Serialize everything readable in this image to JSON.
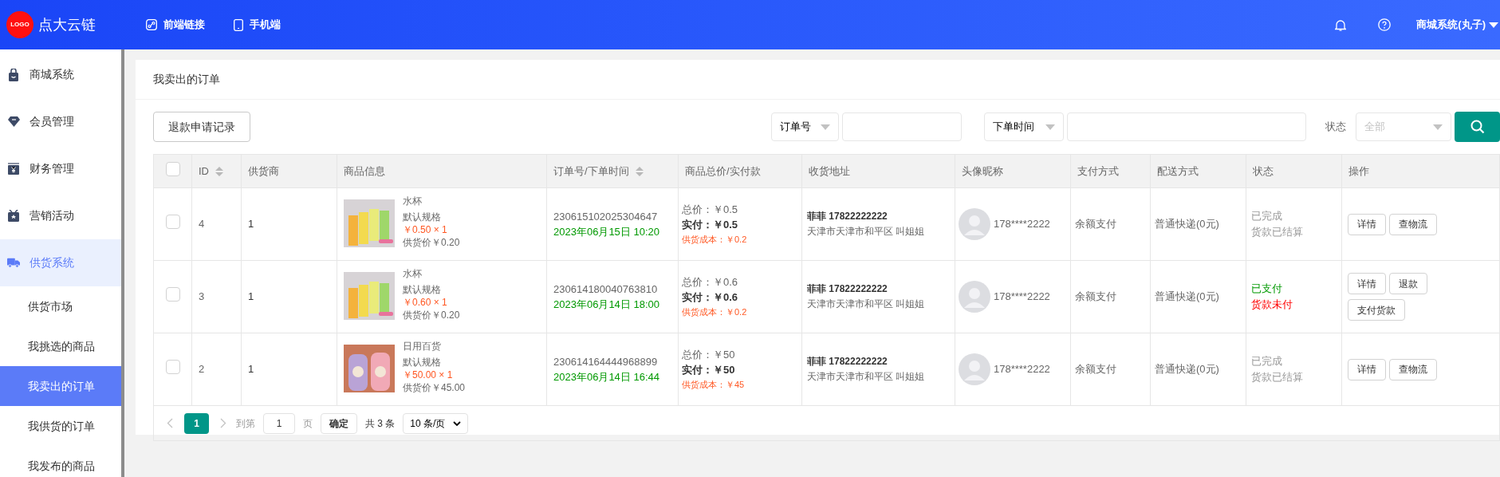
{
  "header": {
    "logo": "LOGO",
    "brand": "点大云链",
    "nav": [
      {
        "label": "前端链接",
        "kind": "link"
      },
      {
        "label": "手机端",
        "kind": "phone"
      }
    ],
    "user": "商城系统(丸子)"
  },
  "sidebar": {
    "items": [
      {
        "label": "商城系统",
        "selected": false
      },
      {
        "label": "会员管理",
        "selected": false
      },
      {
        "label": "财务管理",
        "selected": false
      },
      {
        "label": "营销活动",
        "selected": false
      },
      {
        "label": "供货系统",
        "selected": true,
        "children": [
          {
            "label": "供货市场",
            "selected": false
          },
          {
            "label": "我挑选的商品",
            "selected": false
          },
          {
            "label": "我卖出的订单",
            "selected": true
          },
          {
            "label": "我供货的订单",
            "selected": false
          },
          {
            "label": "我发布的商品",
            "selected": false
          }
        ]
      }
    ]
  },
  "page_title": "我卖出的订单",
  "toolbar": {
    "refund_button": "退款申请记录",
    "order_field": "订单号",
    "time_field": "下单时间",
    "status_label": "状态",
    "status_placeholder": "全部"
  },
  "table": {
    "columns": [
      {
        "label": "ID",
        "sortable": true
      },
      {
        "label": "供货商",
        "sortable": false
      },
      {
        "label": "商品信息",
        "sortable": false
      },
      {
        "label": "订单号/下单时间",
        "sortable": true
      },
      {
        "label": "商品总价/实付款",
        "sortable": false
      },
      {
        "label": "收货地址",
        "sortable": false
      },
      {
        "label": "头像昵称",
        "sortable": false
      },
      {
        "label": "支付方式",
        "sortable": false
      },
      {
        "label": "配送方式",
        "sortable": false
      },
      {
        "label": "状态",
        "sortable": false
      },
      {
        "label": "操作",
        "sortable": false
      }
    ],
    "header_checked": false,
    "rows": [
      {
        "checked": false,
        "id": "4",
        "supplier": "1",
        "product": {
          "kind": "cups",
          "name": "水杯",
          "spec": "默认规格",
          "price_qty": "￥0.50 × 1",
          "supply_price": "供货价￥0.20"
        },
        "order_no": "230615102025304647",
        "order_time": "2023年06月15日 10:20",
        "total": "总价：￥0.5",
        "paid": "实付：￥0.5",
        "cost": "供货成本：￥0.2",
        "receiver": "菲菲 17822222222",
        "address": "天津市天津市和平区 叫姐姐",
        "user": "178****2222",
        "payment": "余额支付",
        "shipping": "普通快递(0元)",
        "status": [
          {
            "text": "已完成",
            "kind": "muted"
          },
          {
            "text": "货款已结算",
            "kind": "muted"
          }
        ],
        "actions": [
          "详情",
          "查物流"
        ]
      },
      {
        "checked": false,
        "id": "3",
        "supplier": "1",
        "product": {
          "kind": "cups",
          "name": "水杯",
          "spec": "默认规格",
          "price_qty": "￥0.60 × 1",
          "supply_price": "供货价￥0.20"
        },
        "order_no": "230614180040763810",
        "order_time": "2023年06月14日 18:00",
        "total": "总价：￥0.6",
        "paid": "实付：￥0.6",
        "cost": "供货成本：￥0.2",
        "receiver": "菲菲 17822222222",
        "address": "天津市天津市和平区 叫姐姐",
        "user": "178****2222",
        "payment": "余额支付",
        "shipping": "普通快递(0元)",
        "status": [
          {
            "text": "已支付",
            "kind": "success"
          },
          {
            "text": "货款未付",
            "kind": "danger"
          }
        ],
        "actions": [
          "详情",
          "退款",
          "支付货款"
        ]
      },
      {
        "checked": false,
        "id": "2",
        "supplier": "1",
        "product": {
          "kind": "bottles",
          "name": "日用百货",
          "spec": "默认规格",
          "price_qty": "￥50.00 × 1",
          "supply_price": "供货价￥45.00"
        },
        "order_no": "230614164444968899",
        "order_time": "2023年06月14日 16:44",
        "total": "总价：￥50",
        "paid": "实付：￥50",
        "cost": "供货成本：￥45",
        "receiver": "菲菲 17822222222",
        "address": "天津市天津市和平区 叫姐姐",
        "user": "178****2222",
        "payment": "余额支付",
        "shipping": "普通快递(0元)",
        "status": [
          {
            "text": "已完成",
            "kind": "muted"
          },
          {
            "text": "货款已结算",
            "kind": "muted"
          }
        ],
        "actions": [
          "详情",
          "查物流"
        ]
      }
    ]
  },
  "pagination": {
    "pages": [
      {
        "label": "1",
        "selected": true
      }
    ],
    "goto_label": "到第",
    "goto_value": "1",
    "page_unit": "页",
    "confirm": "确定",
    "total": "共 3 条",
    "page_size": "10 条/页"
  }
}
